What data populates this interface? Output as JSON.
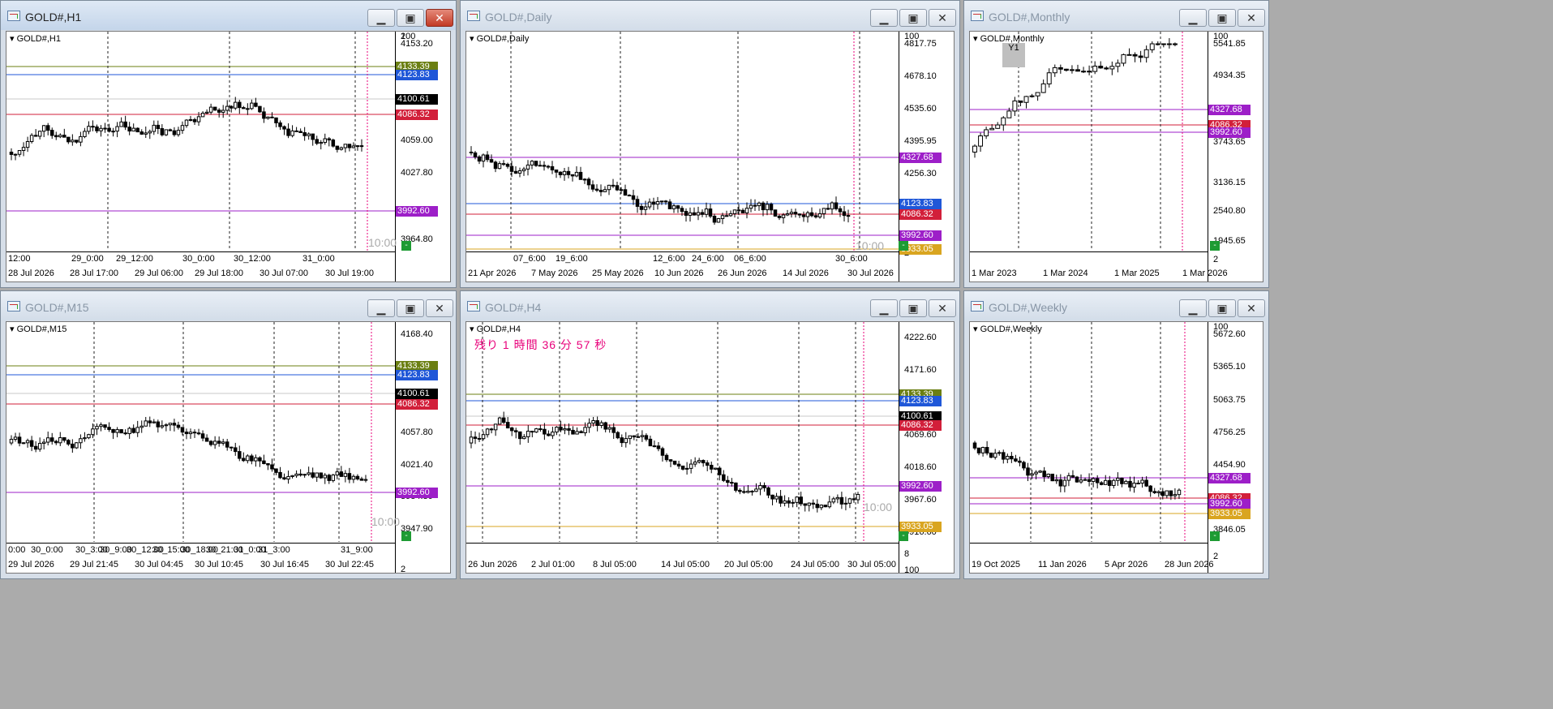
{
  "windows": [
    {
      "title": "GOLD#,H1",
      "active": true,
      "symbol": "GOLD#,H1",
      "y_labels": [
        "4153.20",
        "4059.00",
        "4027.80",
        "3964.80",
        "2",
        "100"
      ],
      "tags": [
        [
          "4133.39",
          "#6b7f12"
        ],
        [
          "4123.83",
          "#1f57d8"
        ],
        [
          "4100.61",
          "#000000"
        ],
        [
          "4086.32",
          "#d21f3a"
        ],
        [
          "3992.60",
          "#9d1fc8"
        ]
      ],
      "x_top": [
        "12:00",
        "29_0:00",
        "29_12:00",
        "30_0:00",
        "30_12:00",
        "31_0:00"
      ],
      "x_bottom": [
        "28 Jul 2026",
        "28 Jul 17:00",
        "29 Jul 06:00",
        "29 Jul 18:00",
        "30 Jul 07:00",
        "30 Jul 19:00"
      ],
      "tf": "10:00",
      "green": "-"
    },
    {
      "title": "GOLD#,Daily",
      "active": false,
      "symbol": "GOLD#,Daily",
      "y_labels": [
        "4817.75",
        "4678.10",
        "4535.60",
        "4395.95",
        "4256.30",
        "2",
        "100"
      ],
      "tags": [
        [
          "4327.68",
          "#9d1fc8"
        ],
        [
          "4123.83",
          "#1f57d8"
        ],
        [
          "4086.32",
          "#d21f3a"
        ],
        [
          "3992.60",
          "#9d1fc8"
        ],
        [
          "3933.05",
          "#d9a520"
        ]
      ],
      "x_top": [
        "07_6:00",
        "19_6:00",
        "12_6:00",
        "24_6:00",
        "06_6:00",
        "30_6:00"
      ],
      "x_bottom": [
        "21 Apr 2026",
        "7 May 2026",
        "25 May 2026",
        "10 Jun 2026",
        "26 Jun 2026",
        "14 Jul 2026",
        "30 Jul 2026"
      ],
      "tf": "10:00",
      "green": "-"
    },
    {
      "title": "GOLD#,Monthly",
      "active": false,
      "symbol": "GOLD#,Monthly",
      "y_labels": [
        "5541.85",
        "4934.35",
        "3743.65",
        "3136.15",
        "2540.80",
        "1945.65",
        "2",
        "100"
      ],
      "tags": [
        [
          "4327.68",
          "#9d1fc8"
        ],
        [
          "4086.32",
          "#d21f3a"
        ],
        [
          "3992.60",
          "#9d1fc8"
        ]
      ],
      "x_bottom": [
        "1 Mar 2023",
        "1 Mar 2024",
        "1 Mar 2025",
        "1 Mar 2026"
      ],
      "badge": "Y1",
      "green": "-"
    },
    {
      "title": "GOLD#,M15",
      "active": false,
      "symbol": "GOLD#,M15",
      "y_labels": [
        "4168.40",
        "4057.80",
        "4021.40",
        "3984.30",
        "3947.90",
        "2",
        "100"
      ],
      "tags": [
        [
          "4133.39",
          "#6b7f12"
        ],
        [
          "4123.83",
          "#1f57d8"
        ],
        [
          "4100.61",
          "#000000"
        ],
        [
          "4086.32",
          "#d21f3a"
        ],
        [
          "3992.60",
          "#9d1fc8"
        ]
      ],
      "x_top": [
        "0:00",
        "30_0:00",
        "30_3:00",
        "30_9:00",
        "30_12:00",
        "30_15:00",
        "30_18:00",
        "30_21:00",
        "31_0:00",
        "31_3:00",
        "31_9:00"
      ],
      "x_bottom": [
        "29 Jul 2026",
        "29 Jul 21:45",
        "30 Jul 04:45",
        "30 Jul 10:45",
        "30 Jul 16:45",
        "30 Jul 22:45"
      ],
      "tf": "10:00",
      "green": "-"
    },
    {
      "title": "GOLD#,H4",
      "active": false,
      "symbol": "GOLD#,H4",
      "countdown": "残り 1 時間 36 分 57 秒",
      "y_labels": [
        "4222.60",
        "4171.60",
        "4069.60",
        "4018.60",
        "3967.60",
        "3916.60",
        "8",
        "100"
      ],
      "tags": [
        [
          "4133.39",
          "#6b7f12"
        ],
        [
          "4123.83",
          "#1f57d8"
        ],
        [
          "4100.61",
          "#000000"
        ],
        [
          "4086.32",
          "#d21f3a"
        ],
        [
          "3992.60",
          "#9d1fc8"
        ],
        [
          "3933.05",
          "#d9a520"
        ]
      ],
      "x_bottom": [
        "26 Jun 2026",
        "2 Jul 01:00",
        "8 Jul 05:00",
        "14 Jul 05:00",
        "20 Jul 05:00",
        "24 Jul 05:00",
        "30 Jul 05:00"
      ],
      "tf": "10:00",
      "green": "-"
    },
    {
      "title": "GOLD#,Weekly",
      "active": false,
      "symbol": "GOLD#,Weekly",
      "y_labels": [
        "5672.60",
        "5365.10",
        "5063.75",
        "4756.25",
        "4454.90",
        "3846.05",
        "2",
        "100"
      ],
      "tags": [
        [
          "4327.68",
          "#9d1fc8"
        ],
        [
          "4086.32",
          "#d21f3a"
        ],
        [
          "3992.60",
          "#9d1fc8"
        ],
        [
          "3933.05",
          "#d9a520"
        ]
      ],
      "x_bottom": [
        "19 Oct 2025",
        "11 Jan 2026",
        "5 Apr 2026",
        "28 Jun 2026"
      ],
      "green": "-"
    }
  ],
  "colors": {
    "blue": "#1f57d8",
    "red": "#d21f3a",
    "purple": "#9d1fc8",
    "olive": "#6b7f12",
    "gold": "#d9a520",
    "magenta": "#e8007a"
  }
}
